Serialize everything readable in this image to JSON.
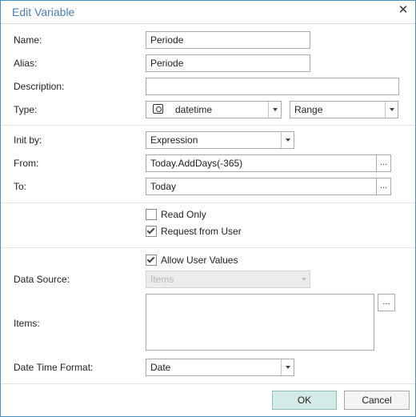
{
  "dialog": {
    "title": "Edit Variable",
    "close_icon": "close-icon"
  },
  "labels": {
    "name": "Name:",
    "alias": "Alias:",
    "description": "Description:",
    "type": "Type:",
    "init_by": "Init by:",
    "from": "From:",
    "to": "To:",
    "data_source": "Data Source:",
    "items": "Items:",
    "date_time_format": "Date Time Format:"
  },
  "fields": {
    "name": "Periode",
    "alias": "Periode",
    "description": "",
    "type": "datetime",
    "type_icon": "datetime-icon",
    "range": "Range",
    "init_by": "Expression",
    "from": "Today.AddDays(-365)",
    "to": "Today",
    "data_source": "Items",
    "items": "",
    "date_time_format": "Date"
  },
  "checkboxes": {
    "read_only": {
      "label": "Read Only",
      "checked": false
    },
    "request_from_user": {
      "label": "Request from User",
      "checked": true
    },
    "allow_user_values": {
      "label": "Allow User Values",
      "checked": true
    }
  },
  "ellipsis": "...",
  "buttons": {
    "ok": "OK",
    "cancel": "Cancel"
  }
}
